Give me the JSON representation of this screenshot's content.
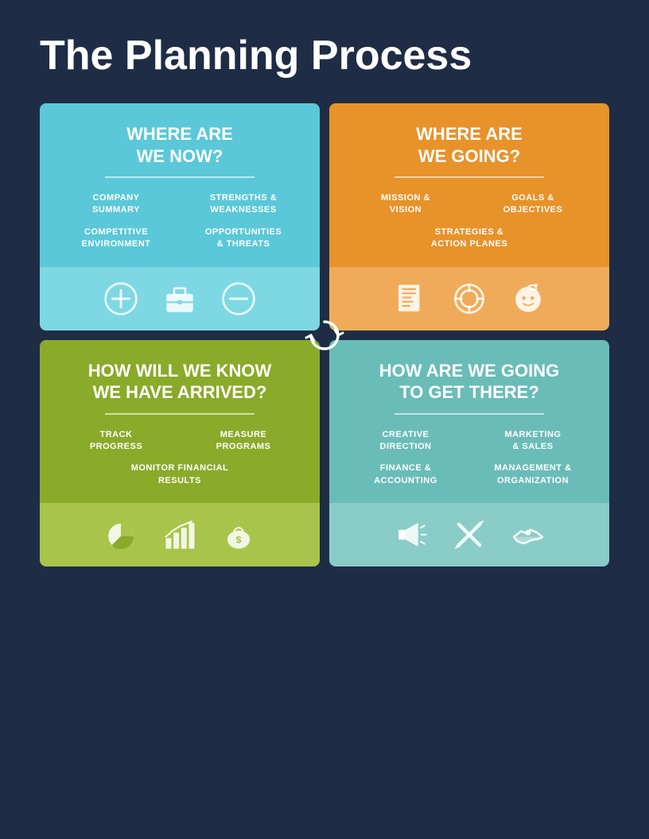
{
  "page": {
    "title": "The Planning Process",
    "background": "#1e2d45"
  },
  "cards": [
    {
      "id": "card-1",
      "question": "WHERE ARE\nWE NOW?",
      "color_top": "#5ac8d8",
      "color_bottom": "#7dd8e4",
      "items": [
        "COMPANY\nSUMMARY",
        "STRENGTHS &\nWEAKNESSES",
        "COMPETITIVE\nENVIRONMENT",
        "OPPORTUNITIES\n& THREATS"
      ],
      "icons": [
        "plus",
        "briefcase",
        "minus"
      ]
    },
    {
      "id": "card-2",
      "question": "WHERE ARE\nWE GOING?",
      "color_top": "#e8922a",
      "color_bottom": "#f0ab5a",
      "items": [
        "MISSION &\nVISION",
        "GOALS &\nOBJECTIVES",
        "STRATEGIES &\nACTION PLANES"
      ],
      "icons": [
        "checklist",
        "target",
        "think"
      ]
    },
    {
      "id": "card-3",
      "question": "HOW WILL WE KNOW\nWE HAVE ARRIVED?",
      "color_top": "#8aaa2a",
      "color_bottom": "#a8c44a",
      "items": [
        "TRACK\nPROGRESS",
        "MEASURE\nPROGRAMS",
        "MONITOR FINANCIAL\nRESULTS"
      ],
      "icons": [
        "pie-chart",
        "bar-chart",
        "money"
      ]
    },
    {
      "id": "card-4",
      "question": "HOW ARE WE GOING\nTO GET THERE?",
      "color_top": "#6abcb8",
      "color_bottom": "#8accc8",
      "items": [
        "CREATIVE\nDIRECTION",
        "MARKETING\n& SALES",
        "FINANCE &\nACCOUNTING",
        "MANAGEMENT &\nORGANIZATION"
      ],
      "icons": [
        "megaphone",
        "tools",
        "handshake"
      ]
    }
  ]
}
